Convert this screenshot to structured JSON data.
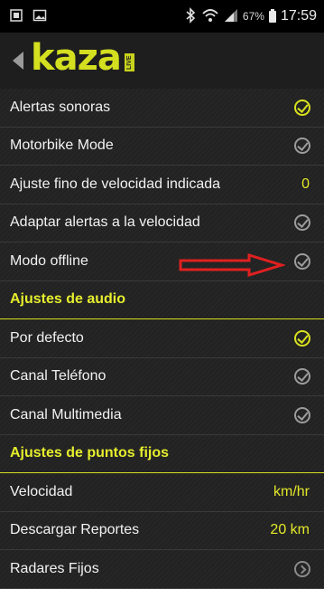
{
  "status_bar": {
    "battery_percent": "67%",
    "time": "17:59"
  },
  "app_bar": {
    "logo_text": "kaza",
    "badge_text": "LIVE"
  },
  "rows": [
    {
      "kind": "item",
      "label": "Alertas sonoras",
      "control": "check",
      "checked": true
    },
    {
      "kind": "item",
      "label": "Motorbike Mode",
      "control": "check",
      "checked": false
    },
    {
      "kind": "item",
      "label": "Ajuste fino de velocidad indicada",
      "control": "value",
      "value": "0"
    },
    {
      "kind": "item",
      "label": "Adaptar alertas a la velocidad",
      "control": "check",
      "checked": false
    },
    {
      "kind": "item",
      "label": "Modo offline",
      "control": "check",
      "checked": false
    },
    {
      "kind": "section",
      "label": "Ajustes de audio"
    },
    {
      "kind": "item",
      "label": "Por defecto",
      "control": "check",
      "checked": true
    },
    {
      "kind": "item",
      "label": "Canal Teléfono",
      "control": "check",
      "checked": false
    },
    {
      "kind": "item",
      "label": "Canal Multimedia",
      "control": "check",
      "checked": false
    },
    {
      "kind": "section",
      "label": "Ajustes de puntos fijos"
    },
    {
      "kind": "item",
      "label": "Velocidad",
      "control": "value",
      "value": "km/hr"
    },
    {
      "kind": "item",
      "label": "Descargar Reportes",
      "control": "value",
      "value": "20 km"
    },
    {
      "kind": "item",
      "label": "Radares Fijos",
      "control": "chevron"
    }
  ],
  "colors": {
    "accent": "#d9e21f",
    "annotation_arrow": "#e02020"
  }
}
